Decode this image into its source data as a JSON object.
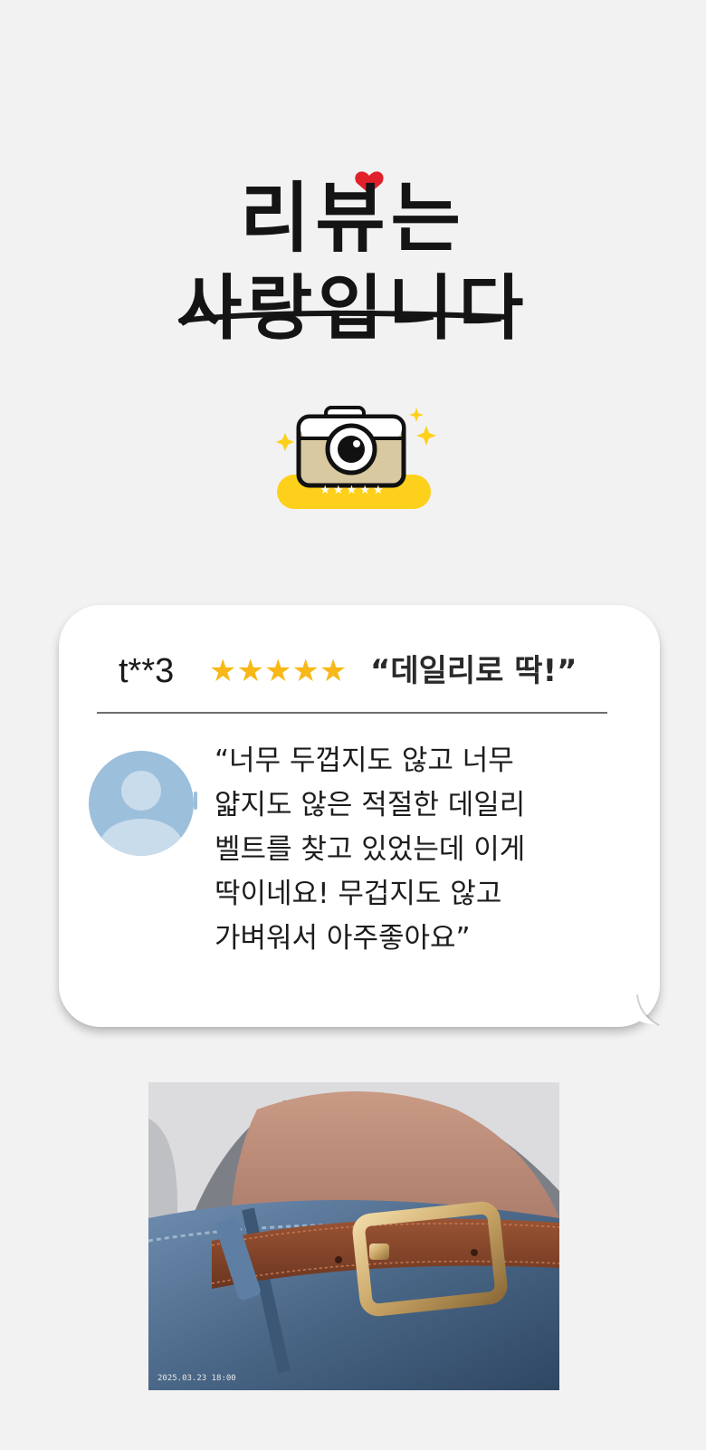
{
  "hero": {
    "line1": "리뷰는",
    "line2": "사랑입니다"
  },
  "badge": {
    "stars": "★★★★★",
    "icon": "camera-icon"
  },
  "review": {
    "reviewer": "t**3",
    "stars": "★★★★★",
    "rating": 5,
    "headline": "“데일리로 딱!”",
    "avatar_icon": "user-avatar-icon",
    "quote": "“너무 두껍지도 않고 너무\n얇지도 않은 적절한 데일리\n벨트를 찾고 있었는데 이게\n딱이네요! 무겁지도 않고\n가벼워서 아주좋아요”"
  },
  "photo": {
    "timestamp": "2025.03.23 18:00",
    "subject": "brown-leather-belt-photo"
  },
  "colors": {
    "background": "#f2f2f2",
    "star": "#f8b818",
    "badge_yellow": "#fdd11b",
    "heart": "#e0202a"
  }
}
